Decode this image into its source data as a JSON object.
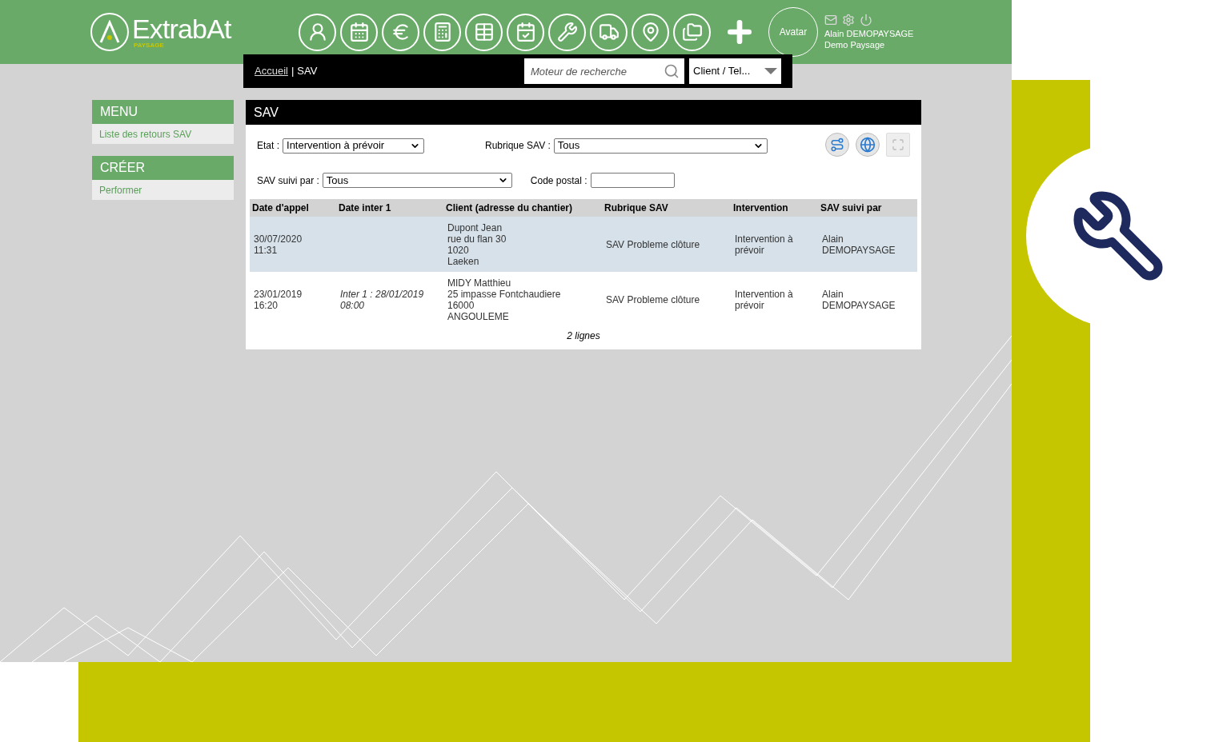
{
  "header": {
    "logo": {
      "name": "ExtrabAt",
      "sub": "PAYSAGE"
    },
    "avatar": "Avatar",
    "user_name": "Alain DEMOPAYSAGE",
    "company": "Demo Paysage"
  },
  "breadcrumb": {
    "link": "Accueil",
    "separator": "|",
    "current": "SAV"
  },
  "search": {
    "placeholder": "Moteur de recherche",
    "scope": "Client / Tel..."
  },
  "sidebar": [
    {
      "title": "MENU",
      "items": [
        "Liste des retours SAV"
      ]
    },
    {
      "title": "CRÉER",
      "items": [
        "Performer"
      ]
    }
  ],
  "panel": {
    "title": "SAV",
    "filters": [
      {
        "label": "Etat :",
        "value": "Intervention à prévoir",
        "kind": "select"
      },
      {
        "label": "Rubrique SAV :",
        "value": "Tous",
        "kind": "select"
      },
      {
        "label": "SAV suivi par :",
        "value": "Tous",
        "kind": "select"
      },
      {
        "label": "Code postal :",
        "kind": "input"
      }
    ],
    "table": {
      "columns": [
        "Date d'appel",
        "Date inter 1",
        "Client (adresse du chantier)",
        "Rubrique SAV",
        "Intervention",
        "SAV suivi par"
      ],
      "rows": [
        {
          "selected": true,
          "cells": [
            "30/07/2020\n11:31",
            "",
            "Dupont Jean\nrue du flan 30\n1020\nLaeken",
            "SAV Probleme clôture",
            "Intervention à\nprévoir",
            "Alain\nDEMOPAYSAGE"
          ]
        },
        {
          "selected": false,
          "cells": [
            "23/01/2019\n16:20",
            "Inter 1 : 28/01/2019\n08:00",
            "MIDY Matthieu\n25 impasse Fontchaudiere\n16000\nANGOULEME",
            "SAV Probleme clôture",
            "Intervention à\nprévoir",
            "Alain\nDEMOPAYSAGE"
          ]
        }
      ],
      "footer": "2 lignes"
    }
  }
}
